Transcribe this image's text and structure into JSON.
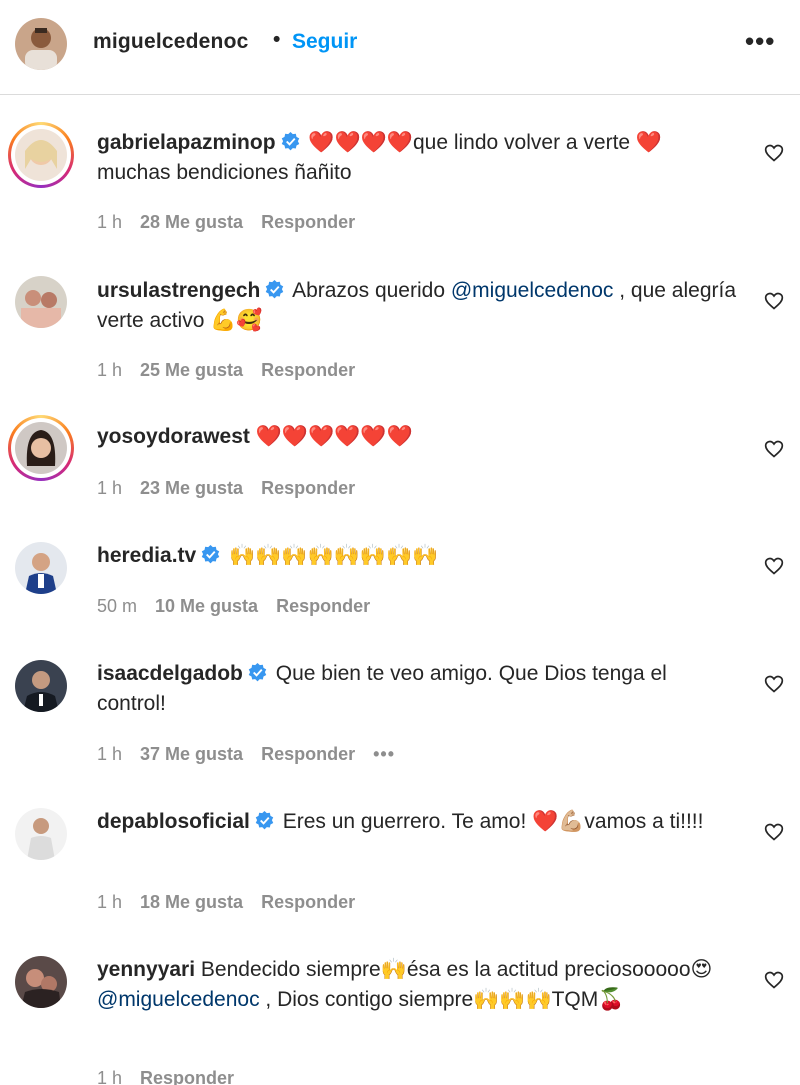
{
  "header": {
    "username": "miguelcedenoc",
    "separator": "•",
    "follow_label": "Seguir",
    "more_label": "•••"
  },
  "comments": [
    {
      "username": "gabrielapazminop",
      "verified": true,
      "emoji_prefix": "❤️❤️❤️❤️",
      "text": "que lindo volver a verte ❤️ muchas bendiciones ñañito",
      "time": "1 h",
      "likes": "28 Me gusta",
      "reply": "Responder"
    },
    {
      "username": "ursulastrengech",
      "verified": true,
      "text_before": "Abrazos querido ",
      "mention": "@miguelcedenoc",
      "text_after": " , que alegría verte activo 💪🥰",
      "time": "1 h",
      "likes": "25 Me gusta",
      "reply": "Responder"
    },
    {
      "username": "yosoydorawest",
      "verified": false,
      "text": "❤️❤️❤️❤️❤️❤️",
      "time": "1 h",
      "likes": "23 Me gusta",
      "reply": "Responder"
    },
    {
      "username": "heredia.tv",
      "verified": true,
      "text": "🙌🙌🙌🙌🙌🙌🙌🙌",
      "time": "50 m",
      "likes": "10 Me gusta",
      "reply": "Responder"
    },
    {
      "username": "isaacdelgadob",
      "verified": true,
      "text": "Que bien te veo amigo. Que Dios tenga el control!",
      "time": "1 h",
      "likes": "37 Me gusta",
      "reply": "Responder",
      "more": "•••"
    },
    {
      "username": "depablosoficial",
      "verified": true,
      "text": "Eres un guerrero. Te amo! ❤️💪🏼vamos a ti!!!!",
      "time": "1 h",
      "likes": "18 Me gusta",
      "reply": "Responder"
    },
    {
      "username": "yennyyari",
      "verified": false,
      "text_before": "Bendecido siempre🙌ésa es la actitud preciosooooo😍",
      "mention": "@miguelcedenoc",
      "text_after": " , Dios contigo siempre🙌🙌🙌TQM🍒",
      "time": "1 h",
      "reply": "Responder"
    }
  ],
  "colors": {
    "text": "#262626",
    "muted": "#8e8e8e",
    "link_blue": "#0095f6",
    "mention": "#00376b",
    "verified": "#3897f0"
  }
}
